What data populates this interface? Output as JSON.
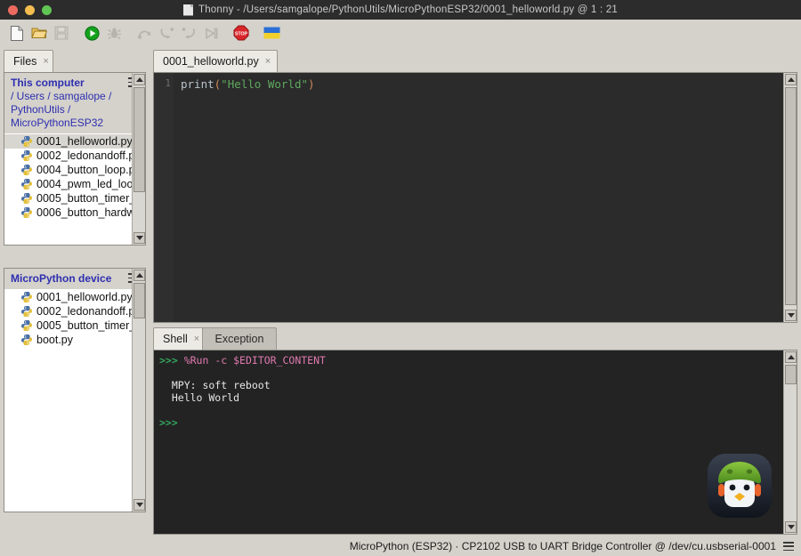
{
  "window": {
    "title": "Thonny  -  /Users/samgalope/PythonUtils/MicroPythonESP32/0001_helloworld.py  @  1 : 21",
    "controls": [
      "close",
      "minimize",
      "maximize"
    ]
  },
  "toolbar": {
    "buttons": [
      {
        "name": "new-file-icon",
        "label": "New",
        "enabled": true
      },
      {
        "name": "open-file-icon",
        "label": "Open",
        "enabled": true
      },
      {
        "name": "save-file-icon",
        "label": "Save",
        "enabled": false
      },
      {
        "name": "run-icon",
        "label": "Run current script",
        "enabled": true
      },
      {
        "name": "debug-icon",
        "label": "Debug current script",
        "enabled": true
      },
      {
        "name": "step-over-icon",
        "label": "Step over",
        "enabled": false
      },
      {
        "name": "step-into-icon",
        "label": "Step into",
        "enabled": false
      },
      {
        "name": "step-out-icon",
        "label": "Step out",
        "enabled": false
      },
      {
        "name": "resume-icon",
        "label": "Resume",
        "enabled": false
      },
      {
        "name": "stop-icon",
        "label": "Stop/Restart backend",
        "enabled": true
      },
      {
        "name": "ukraine-flag-icon",
        "label": "Support Ukraine",
        "enabled": true
      }
    ]
  },
  "files_panel": {
    "tab_label": "Files",
    "this_computer": {
      "title": "This computer",
      "breadcrumb": "/ Users / samgalope / PythonUtils / MicroPythonESP32",
      "crumb_parts": [
        "This computer",
        "/ Users / samgalope /",
        "PythonUtils /",
        "MicroPythonESP32"
      ],
      "files": [
        {
          "name": "0001_helloworld.py",
          "selected": true
        },
        {
          "name": "0002_ledonandoff.p",
          "selected": false
        },
        {
          "name": "0004_button_loop.p",
          "selected": false
        },
        {
          "name": "0004_pwm_led_loop",
          "selected": false
        },
        {
          "name": "0005_button_timer_",
          "selected": false
        },
        {
          "name": "0006_button_hardw",
          "selected": false
        }
      ]
    },
    "device": {
      "title": "MicroPython device",
      "files": [
        {
          "name": "0001_helloworld.py",
          "selected": false
        },
        {
          "name": "0002_ledonandoff.p",
          "selected": false
        },
        {
          "name": "0005_button_timer_",
          "selected": false
        },
        {
          "name": "boot.py",
          "selected": false
        }
      ]
    }
  },
  "editor": {
    "tab_label": "0001_helloworld.py",
    "line_numbers": [
      "1"
    ],
    "code": {
      "func": "print",
      "open_paren": "(",
      "string": "\"Hello World\"",
      "close_paren": ")"
    }
  },
  "shell": {
    "tabs": [
      {
        "label": "Shell",
        "active": true
      },
      {
        "label": "Exception",
        "active": false
      }
    ],
    "lines": [
      {
        "type": "prompt-command",
        "prompt": ">>> ",
        "text": "%Run -c $EDITOR_CONTENT"
      },
      {
        "type": "blank",
        "text": ""
      },
      {
        "type": "output",
        "text": "  MPY: soft reboot"
      },
      {
        "type": "output",
        "text": "  Hello World"
      },
      {
        "type": "blank",
        "text": ""
      },
      {
        "type": "prompt",
        "prompt": ">>>",
        "text": ""
      }
    ],
    "mascot": "penguin-helmet-icon"
  },
  "statusbar": {
    "text": "MicroPython (ESP32)  ·  CP2102 USB to UART Bridge Controller @ /dev/cu.usbserial-0001",
    "menu_icon": "hamburger-menu-icon"
  },
  "colors": {
    "chrome": "#d4d2cb",
    "titlebar": "#2c2c2c",
    "editor_bg": "#2b2b2b",
    "shell_bg": "#232323",
    "accent_blue": "#2e2eb0",
    "prompt_green": "#35a95f",
    "magic_pink": "#e07ab0",
    "string_green": "#5fa85f",
    "paren_orange": "#cf8a5a"
  }
}
